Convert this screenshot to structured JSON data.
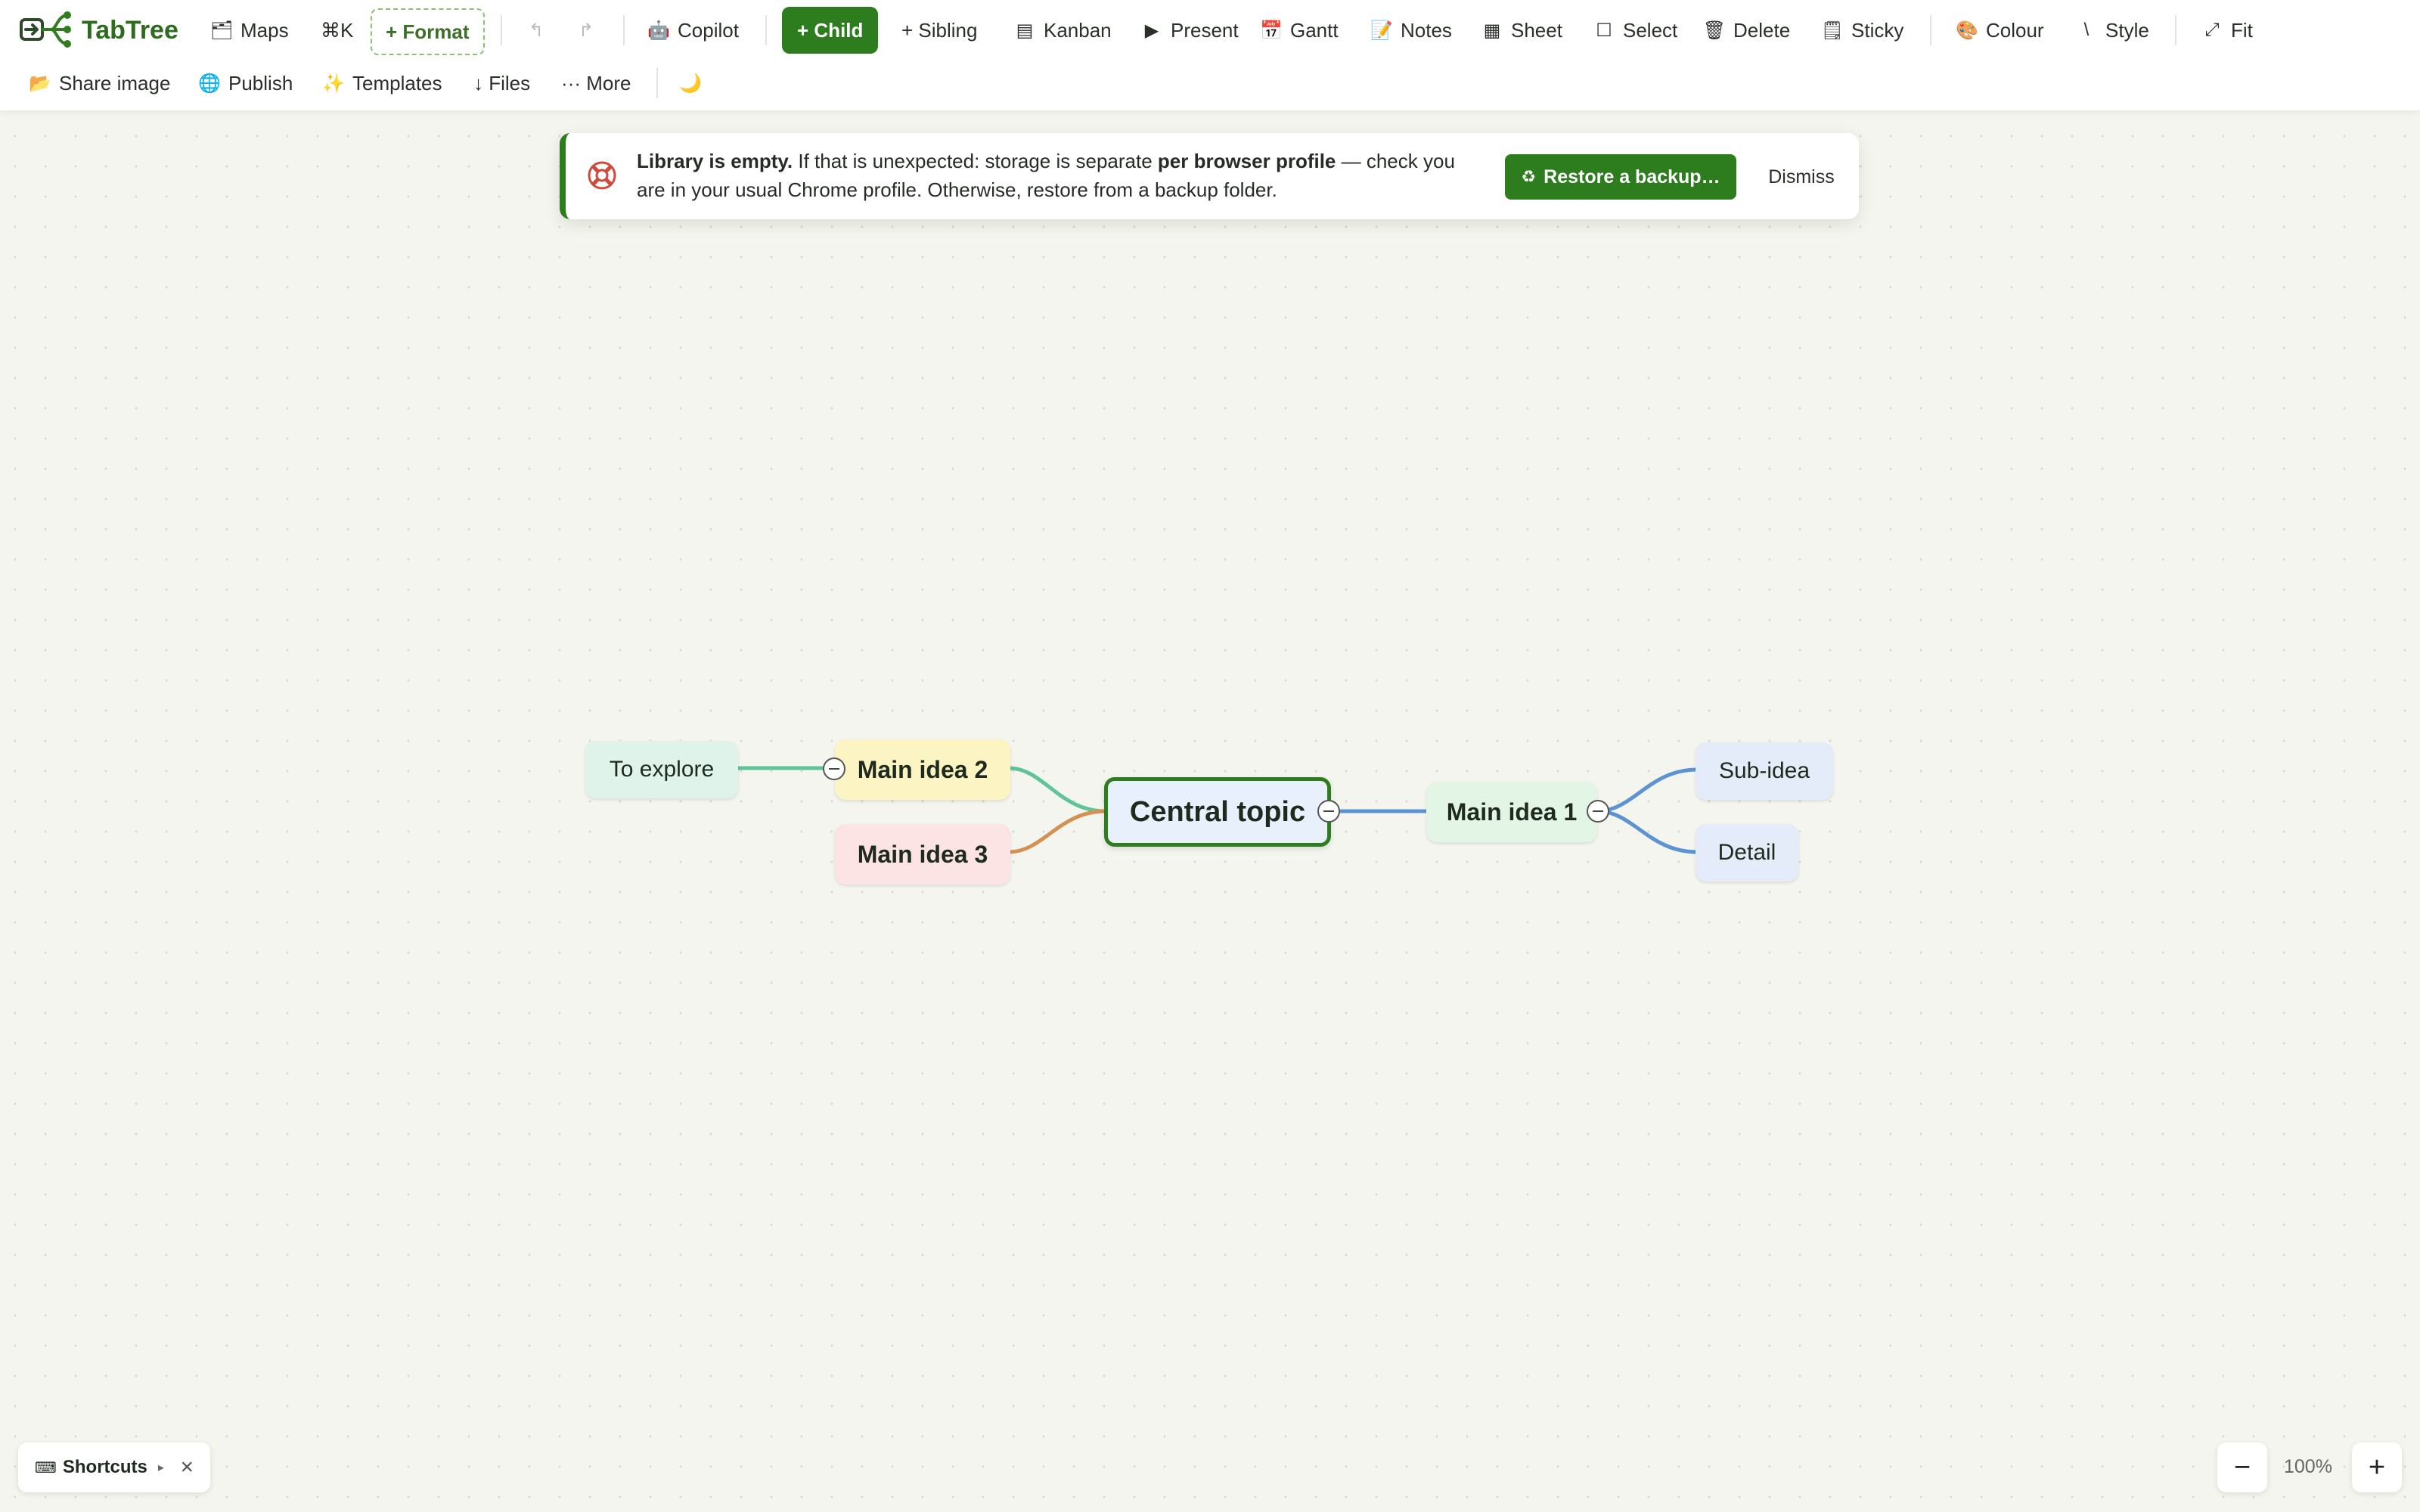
{
  "app": {
    "name": "TabTree"
  },
  "toolbar": {
    "maps": "Maps",
    "shortcut_cmdk": "⌘K",
    "format": "+ Format",
    "copilot": "Copilot",
    "child": "+ Child",
    "sibling": "+ Sibling",
    "kanban": "Kanban",
    "present": "Present",
    "gantt": "Gantt",
    "notes": "Notes",
    "sheet": "Sheet",
    "select": "Select",
    "delete": "Delete",
    "sticky": "Sticky",
    "colour": "Colour",
    "style": "Style",
    "fit": "Fit",
    "share_image": "Share image",
    "publish": "Publish",
    "templates": "Templates",
    "files": "↓ Files",
    "more": "··· More"
  },
  "banner": {
    "lead": "Library is empty.",
    "text1": " If that is unexpected: storage is separate ",
    "emph": "per browser profile",
    "text2": " — check you are in your usual Chrome profile. Otherwise, restore from a backup folder.",
    "restore_label": "Restore a backup…",
    "dismiss_label": "Dismiss"
  },
  "mindmap": {
    "central": "Central topic",
    "main1": "Main idea 1",
    "main2": "Main idea 2",
    "main3": "Main idea 3",
    "explore": "To explore",
    "subidea": "Sub-idea",
    "detail": "Detail"
  },
  "colors": {
    "brand": "#2d7d1f",
    "link_blue": "#5b93d3",
    "link_green": "#5fc497",
    "link_orange": "#d59154"
  },
  "footer": {
    "shortcuts_label": "Shortcuts",
    "zoom": "100%"
  }
}
